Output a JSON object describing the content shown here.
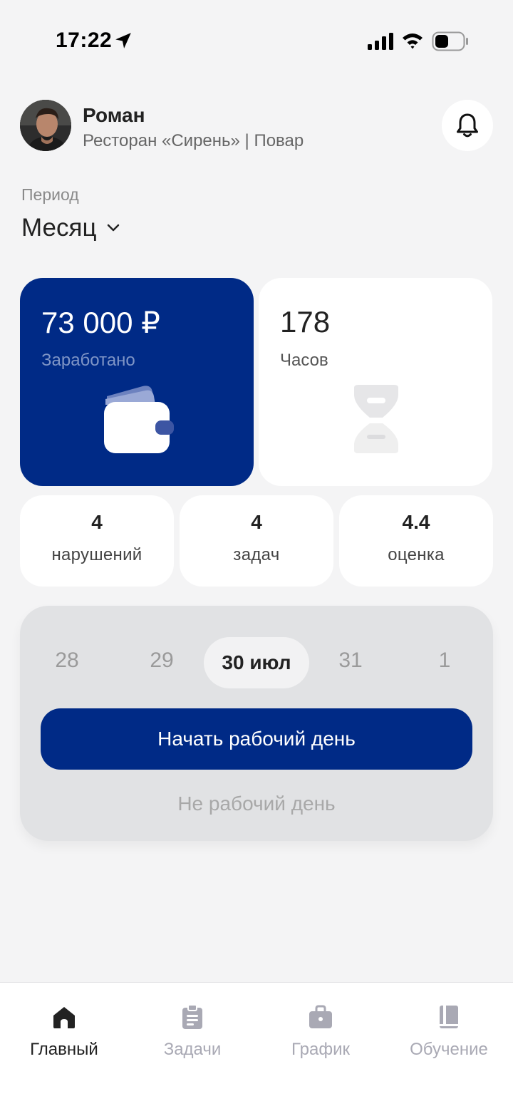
{
  "status_bar": {
    "time": "17:22"
  },
  "profile": {
    "name": "Роман",
    "role": "Ресторан «Сирень» | Повар"
  },
  "period": {
    "label": "Период",
    "value": "Месяц"
  },
  "cards": {
    "earned": {
      "value": "73 000 ₽",
      "label": "Заработано"
    },
    "hours": {
      "value": "178",
      "label": "Часов"
    }
  },
  "stats": [
    {
      "value": "4",
      "label": "нарушений"
    },
    {
      "value": "4",
      "label": "задач"
    },
    {
      "value": "4.4",
      "label": "оценка"
    }
  ],
  "day_panel": {
    "dates": [
      "28",
      "29",
      "30 июл",
      "31",
      "1"
    ],
    "selected_index": 2,
    "start_button": "Начать рабочий день",
    "status": "Не рабочий день"
  },
  "tabs": [
    {
      "label": "Главный",
      "icon": "home-icon",
      "active": true
    },
    {
      "label": "Задачи",
      "icon": "clipboard-icon",
      "active": false
    },
    {
      "label": "График",
      "icon": "briefcase-icon",
      "active": false
    },
    {
      "label": "Обучение",
      "icon": "book-icon",
      "active": false
    }
  ],
  "colors": {
    "brand": "#002a86",
    "background": "#f4f4f5",
    "panel": "#e1e2e4",
    "inactive_tab": "#a9a9b4"
  }
}
